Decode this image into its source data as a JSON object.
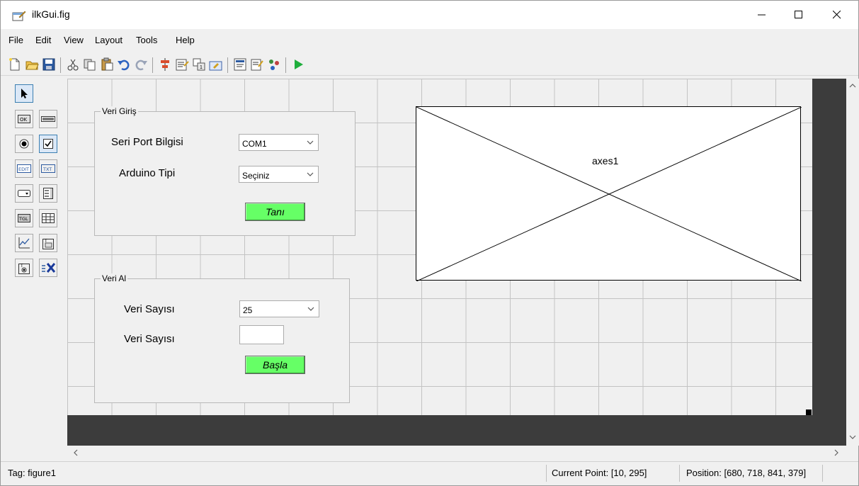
{
  "window": {
    "title": "ilkGui.fig"
  },
  "menu": [
    "File",
    "Edit",
    "View",
    "Layout",
    "Tools",
    "Help"
  ],
  "toolbar": {
    "icons": [
      "new-file-icon",
      "open-folder-icon",
      "save-icon",
      "cut-icon",
      "copy-icon",
      "paste-icon",
      "undo-icon",
      "redo-icon",
      "align-icon",
      "menu-editor-icon",
      "tab-order-icon",
      "toolbar-editor-icon",
      "editor-icon",
      "property-inspector-icon",
      "object-browser-icon",
      "run-icon"
    ]
  },
  "palette": {
    "items": [
      "select-arrow-icon",
      "push-button-icon",
      "slider-icon",
      "radio-button-icon",
      "checkbox-icon",
      "edit-text-icon",
      "static-text-icon",
      "popup-menu-icon",
      "listbox-icon",
      "toggle-button-icon",
      "table-icon",
      "axes-icon",
      "panel-icon",
      "button-group-icon",
      "activex-icon"
    ],
    "labels": {
      "push_button": "OK",
      "edit_text": "EDIT",
      "static_text": "TXT",
      "toggle": "TGL"
    }
  },
  "panels": {
    "veri_giris": {
      "title": "Veri Giriş",
      "port_label": "Seri Port Bilgisi",
      "port_value": "COM1",
      "board_label": "Arduino Tipi",
      "board_value": "Seçiniz",
      "button": "Tanı"
    },
    "veri_al": {
      "title": "Veri Al",
      "count_label": "Veri Sayısı",
      "count_value": "25",
      "count_label2": "Veri Sayısı",
      "button": "Başla"
    }
  },
  "axes": {
    "label": "axes1"
  },
  "status": {
    "tag": "Tag: figure1",
    "current_point": "Current Point:  [10, 295]",
    "position": "Position: [680, 718, 841, 379]"
  },
  "colors": {
    "button_green": "#66ff66",
    "dark_area": "#3c3c3c",
    "grid": "#c3c3c3"
  }
}
